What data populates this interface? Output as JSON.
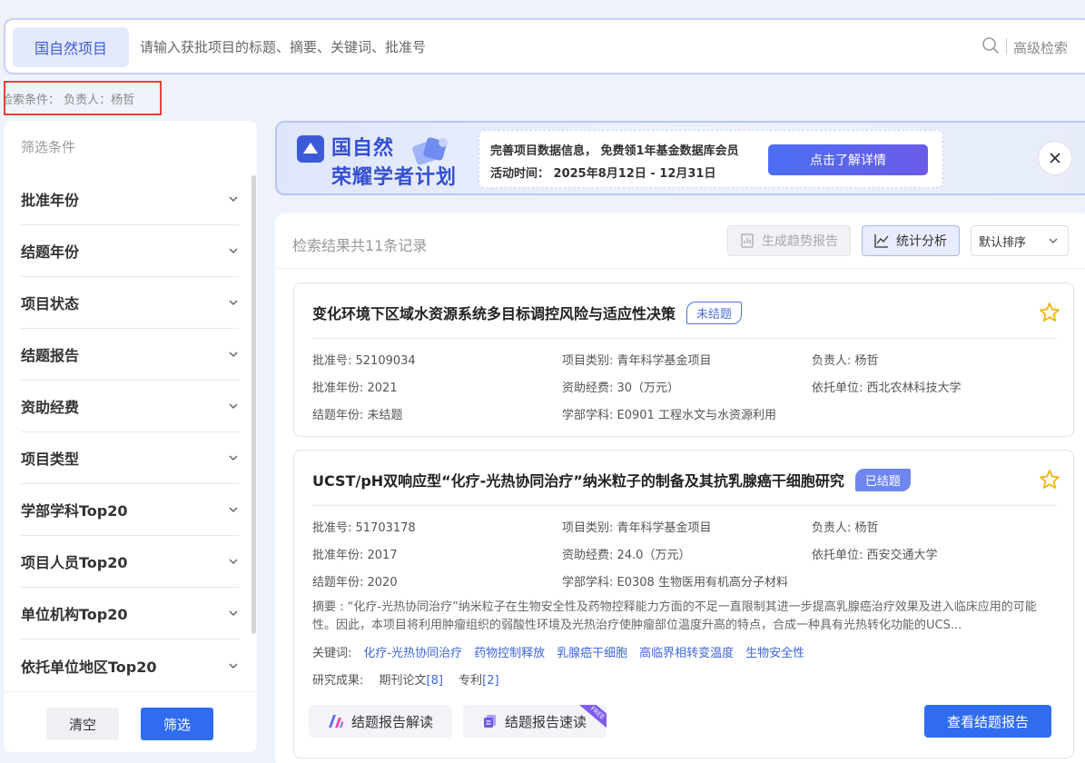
{
  "search": {
    "scope_label": "国自然项目",
    "placeholder": "请输入获批项目的标题、摘要、关键词、批准号",
    "advanced_label": "高级检索"
  },
  "criteria": {
    "text": "检索条件： 负责人：杨哲"
  },
  "filters": {
    "title": "筛选条件",
    "items": [
      "批准年份",
      "结题年份",
      "项目状态",
      "结题报告",
      "资助经费",
      "项目类型",
      "学部学科Top20",
      "项目人员Top20",
      "单位机构Top20",
      "依托单位地区Top20"
    ],
    "clear_label": "清空",
    "apply_label": "筛选"
  },
  "banner": {
    "title_line1": "国自然",
    "title_line2": "荣耀学者计划",
    "line1": "完善项目数据信息， 免费领1年基金数据库会员",
    "line2": "活动时间： 2025年8月12日 - 12月31日",
    "cta": "点击了解详情"
  },
  "results": {
    "count_text": "检索结果共11条记录",
    "trend_label": "生成趋势报告",
    "stats_label": "统计分析",
    "sort_label": "默认排序",
    "cards": [
      {
        "title": "变化环境下区域水资源系统多目标调控风险与适应性决策",
        "status": "未结题",
        "approval_no": "批准号: 52109034",
        "category": "项目类别: 青年科学基金项目",
        "leader": "负责人: 杨哲",
        "approval_year": "批准年份: 2021",
        "funding": "资助经费: 30（万元）",
        "institution": "依托单位: 西北农林科技大学",
        "end_year": "结题年份: 未结题",
        "discipline": "学部学科: E0901 工程水文与水资源利用"
      },
      {
        "title": "UCST/pH双响应型“化疗-光热协同治疗”纳米粒子的制备及其抗乳腺癌干细胞研究",
        "status": "已结题",
        "approval_no": "批准号: 51703178",
        "category": "项目类别: 青年科学基金项目",
        "leader": "负责人: 杨哲",
        "approval_year": "批准年份: 2017",
        "funding": "资助经费: 24.0（万元）",
        "institution": "依托单位: 西安交通大学",
        "end_year": "结题年份: 2020",
        "discipline": "学部学科: E0308 生物医用有机高分子材料",
        "abstract": "摘要 : “化疗-光热协同治疗”纳米粒子在生物安全性及药物控释能力方面的不足一直限制其进一步提高乳腺癌治疗效果及进入临床应用的可能性。因此，本项目将利用肿瘤组织的弱酸性环境及光热治疗使肿瘤部位温度升高的特点，合成一种具有光热转化功能的UCS...",
        "keywords_label": "关键词:",
        "keywords": [
          "化疗-光热协同治疗",
          "药物控制释放",
          "乳腺癌干细胞",
          "高临界相转变温度",
          "生物安全性"
        ],
        "outputs_label": "研究成果:",
        "output_paper": "期刊论文",
        "output_paper_count": "[8]",
        "output_patent": "专利",
        "output_patent_count": "[2]",
        "btn_ai": "结题报告解读",
        "btn_quick": "结题报告速读",
        "free_tag": "FREE",
        "btn_report": "查看结题报告"
      }
    ]
  },
  "colors": {
    "accent": "#2f6cf0",
    "brand": "#3550d0",
    "criteria_border": "#e2413b"
  }
}
